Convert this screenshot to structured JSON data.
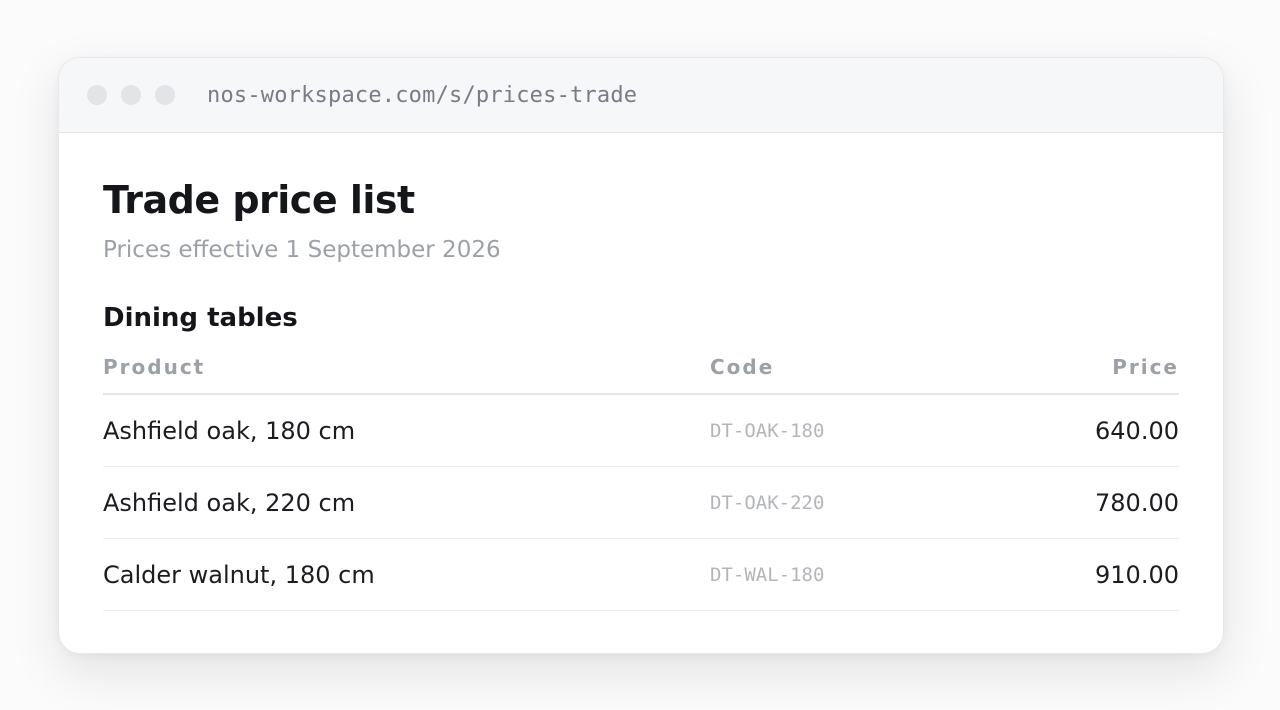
{
  "browser": {
    "url": "nos-workspace.com/s/prices-trade"
  },
  "page": {
    "title": "Trade price list",
    "subtitle": "Prices effective 1 September 2026"
  },
  "section": {
    "title": "Dining tables"
  },
  "table": {
    "headers": {
      "product": "Product",
      "code": "Code",
      "price": "Price"
    },
    "rows": [
      {
        "product": "Ashfield oak, 180 cm",
        "code": "DT-OAK-180",
        "price": "640.00"
      },
      {
        "product": "Ashfield oak, 220 cm",
        "code": "DT-OAK-220",
        "price": "780.00"
      },
      {
        "product": "Calder walnut, 180 cm",
        "code": "DT-WAL-180",
        "price": "910.00"
      }
    ]
  }
}
